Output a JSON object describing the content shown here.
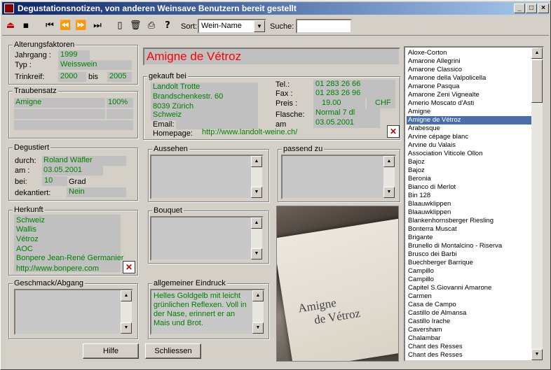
{
  "window": {
    "title": "Degustationsnotizen, von anderen Weinsave Benutzern bereit gestellt"
  },
  "toolbar": {
    "sort_label": "Sort:",
    "sort_value": "Wein-Name",
    "search_label": "Suche:",
    "search_value": ""
  },
  "alterung": {
    "title": "Alterungsfaktoren",
    "jahrgang_label": "Jahrgang :",
    "jahrgang": "1999",
    "typ_label": "Typ :",
    "typ": "Weisswein",
    "trinkreif_label": "Trinkreif:",
    "trinkreif_from": "2000",
    "bis_label": "bis",
    "trinkreif_to": "2005"
  },
  "wine_name": "Amigne de Vétroz",
  "traubensatz": {
    "title": "Traubensatz",
    "grape": "Amigne",
    "percent": "100%"
  },
  "gekauft": {
    "title": "gekauft bei",
    "name": "Landolt Trotte",
    "street": "Brandschenkestr. 60",
    "city": "8039 Zürich",
    "country": "Schweiz",
    "email_label": "Email:",
    "email": "",
    "homepage_label": "Homepage:",
    "homepage": "http://www.landolt-weine.ch/",
    "tel_label": "Tel.:",
    "tel": "01 283 26 66",
    "fax_label": "Fax :",
    "fax": "01 283 26 96",
    "preis_label": "Preis :",
    "preis": "19.00",
    "currency": "CHF",
    "flasche_label": "Flasche:",
    "flasche": "Normal 7 dl",
    "am_label": "am",
    "am": "03.05.2001"
  },
  "degustiert": {
    "title": "Degustiert",
    "durch_label": "durch:",
    "durch": "Roland Wäfler",
    "am_label": "am :",
    "am": "03.05.2001",
    "bei_label": "bei:",
    "bei": "10",
    "grad_label": "Grad",
    "dekantiert_label": "dekantiert:",
    "dekantiert": "Nein"
  },
  "aussehen": {
    "title": "Aussehen"
  },
  "passend": {
    "title": "passend zu"
  },
  "herkunft": {
    "title": "Herkunft",
    "land": "Schweiz",
    "region": "Wallis",
    "ort": "Vétroz",
    "klasse": "AOC",
    "produzent": "Bonpere Jean-René Germanier",
    "url": "http://www.bonpere.com"
  },
  "bouquet": {
    "title": "Bouquet"
  },
  "geschmack": {
    "title": "Geschmack/Abgang"
  },
  "eindruck": {
    "title": "allgemeiner Eindruck",
    "text": "Helles Goldgelb mit leicht grünlichen Reflexen. Voll in der Nase, erinnert er an Mais und Brot."
  },
  "photo_label": {
    "line1": "Amigne",
    "line2": "de Vétroz"
  },
  "buttons": {
    "hilfe": "Hilfe",
    "schliessen": "Schliessen"
  },
  "wine_list": [
    "Aloxe-Corton",
    "Amarone Allegrini",
    "Amarone Classico",
    "Amarone della Valpolicella",
    "Amarone Pasqua",
    "Amarone Zeni Vignealte",
    "Amerio Moscato d'Asti",
    "Amigne",
    "Amigne de Vétroz",
    "Arabesque",
    "Arvine cépage blanc",
    "Arvine du Valais",
    "Association Viticole Ollon",
    "Bajoz",
    "Bajoz",
    "Beronia",
    "Bianco di Merlot",
    "Bin 128",
    "Blaauwklippen",
    "Blaauwklippen",
    "Blankenhornsberger Riesling",
    "Bonterra Muscat",
    "Brigante",
    "Brunello di Montalcino - Riserva",
    "Brusco dei Barbi",
    "Buechberger Barrique",
    "Campillo",
    "Campillo",
    "Capitel S.Giovanni Amarone",
    "Carmen",
    "Casa de Campo",
    "Castillo de Almansa",
    "Castillo Irache",
    "Caversham",
    "Chalambar",
    "Chant des Resses",
    "Chant des Resses"
  ],
  "selected_index": 8
}
